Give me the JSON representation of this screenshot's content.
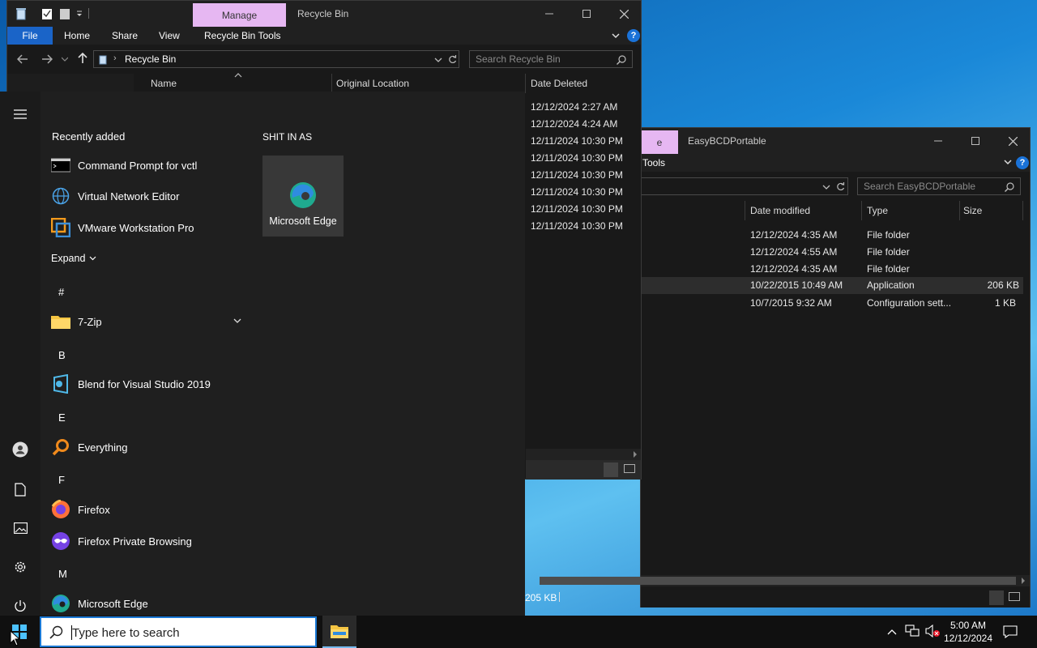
{
  "recycle": {
    "manage_label": "Manage",
    "title": "Recycle Bin",
    "ribbon_tabs": [
      "File",
      "Home",
      "Share",
      "View",
      "Recycle Bin Tools"
    ],
    "address": "Recycle Bin",
    "search_placeholder": "Search Recycle Bin",
    "columns": [
      "Name",
      "Original Location",
      "Date Deleted"
    ],
    "dates": [
      "12/12/2024 2:27 AM",
      "12/12/2024 4:24 AM",
      "12/11/2024 10:30 PM",
      "12/11/2024 10:30 PM",
      "12/11/2024 10:30 PM",
      "12/11/2024 10:30 PM",
      "12/11/2024 10:30 PM",
      "12/11/2024 10:30 PM"
    ]
  },
  "easybcd": {
    "manage_fragment": "e",
    "title": "EasyBCDPortable",
    "ribbon_fragment": "Tools",
    "search_placeholder": "Search EasyBCDPortable",
    "columns": [
      "Date modified",
      "Type",
      "Size"
    ],
    "rows": [
      {
        "date": "12/12/2024 4:35 AM",
        "type": "File folder",
        "size": ""
      },
      {
        "date": "12/12/2024 4:55 AM",
        "type": "File folder",
        "size": ""
      },
      {
        "date": "12/12/2024 4:35 AM",
        "type": "File folder",
        "size": ""
      },
      {
        "date": "10/22/2015 10:49 AM",
        "type": "Application",
        "size": "206 KB"
      },
      {
        "date": "10/7/2015 9:32 AM",
        "type": "Configuration sett...",
        "size": "1 KB"
      }
    ],
    "status_text": "205 KB"
  },
  "start_menu": {
    "recently_added_label": "Recently added",
    "recent": [
      "Command Prompt for vctl",
      "Virtual Network Editor",
      "VMware Workstation Pro"
    ],
    "expand_label": "Expand",
    "letters": [
      "#",
      "B",
      "E",
      "F",
      "M"
    ],
    "apps": {
      "seven_zip": "7-Zip",
      "blend": "Blend for Visual Studio 2019",
      "everything": "Everything",
      "firefox": "Firefox",
      "firefox_private": "Firefox Private Browsing",
      "edge": "Microsoft Edge"
    },
    "group_title": "SHIT IN AS",
    "tile_label": "Microsoft Edge"
  },
  "taskbar": {
    "search_placeholder": "Type here to search",
    "time": "5:00 AM",
    "date": "12/12/2024"
  },
  "colors": {
    "accent": "#1a64c8",
    "manage_tab": "#e6b7f2",
    "window_bg": "#191919",
    "start_bg": "#1f1f1f"
  }
}
